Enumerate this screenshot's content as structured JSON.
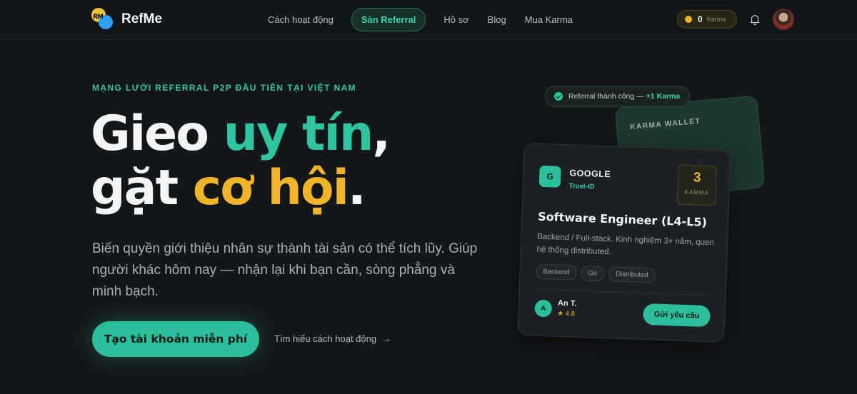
{
  "nav": {
    "logo_text": "RefMe",
    "logo_mark_text": "RM",
    "links": [
      "Cách hoạt động",
      "Sàn Referral",
      "Hồ sơ",
      "Blog",
      "Mua Karma"
    ],
    "active_link": "Sàn Referral",
    "karma_count": "0",
    "karma_label": "Karma"
  },
  "hero": {
    "eyebrow": "MẠNG LƯỚI REFERRAL P2P ĐẦU TIÊN TẠI VIỆT NAM",
    "line1_a": "Gieo ",
    "line1_b": "uy tín",
    "line1_c": ",",
    "line2_a": "gặt ",
    "line2_b": "cơ hội",
    "line2_c": ".",
    "lead": "Biến quyền giới thiệu nhân sự thành tài sản có thể tích lũy. Giúp người khác hôm nay — nhận lại khi bạn cần, sòng phẳng và minh bạch.",
    "cta_label": "Tạo tài khoản miễn phí",
    "learn_label": "Tìm hiểu cách hoạt động",
    "learn_arrow": "→"
  },
  "toast": {
    "text": "Referral thành công —",
    "plus": "+1 Karma"
  },
  "wallet": {
    "label": "KARMA WALLET"
  },
  "job_card": {
    "company_initial": "G",
    "company": "GOOGLE",
    "trust_label": "Trust-ID",
    "karma_cost": "3",
    "karma_cost_label": "KARMA",
    "role": "Software Engineer (L4-L5)",
    "description": "Backend / Full-stack. Kinh nghiệm 3+ năm, quen hệ thống distributed.",
    "tags": [
      "Backend",
      "Go",
      "Distributed"
    ],
    "referrer_initial": "A",
    "referrer_name": "An T.",
    "referrer_rating": "★ 4.8",
    "request_label": "Gửi yêu cầu"
  },
  "colors": {
    "accent_green": "#2fc4a0",
    "accent_yellow": "#f0b429",
    "background": "#14171a"
  },
  "icons": [
    "bell-icon",
    "check-circle-icon",
    "coin-icon",
    "arrow-right-icon"
  ]
}
